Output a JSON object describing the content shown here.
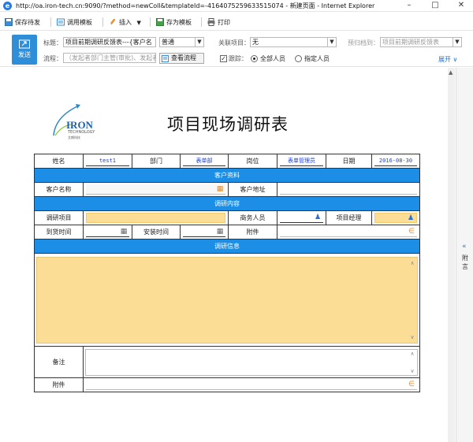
{
  "window": {
    "title": "http://oa.iron-tech.cn:9090/?method=newColl&templateId=-4164075259633515074 - 新建页面 - Internet Explorer",
    "ie_icon": "e"
  },
  "toolbar": {
    "save_draft": "保存待发",
    "use_template": "调用模板",
    "insert": "插入",
    "save_template": "存为模板",
    "print": "打印"
  },
  "header": {
    "send_label": "发送",
    "title_label": "标题：",
    "title_value": "项目前期调研反馈表---{客户名",
    "priority_value": "普通",
    "related_label": "关联项目：",
    "related_value": "无",
    "archive_label": "预归档到：",
    "archive_placeholder": "项目前期调研反馈表",
    "flow_label": "流程：",
    "flow_placeholder": "（发起者部门主管(审批)、发起者",
    "view_flow": "查看流程",
    "track_label": "跟踪：",
    "all_people": "全部人员",
    "specified_people": "指定人员",
    "expand": "展开"
  },
  "side_panel": {
    "label": "附言"
  },
  "document": {
    "logo_brand": "IRON",
    "logo_sub": "TECHNOLOGY",
    "logo_cn": "艾朗科技",
    "title": "项目现场调研表",
    "rows": {
      "name_label": "姓名",
      "name_value": "test1",
      "dept_label": "部门",
      "dept_value": "表单部",
      "post_label": "岗位",
      "post_value": "表单管理员",
      "date_label": "日期",
      "date_value": "2016-08-30",
      "section_customer": "客户资料",
      "customer_name_label": "客户名称",
      "customer_addr_label": "客户地址",
      "section_content": "调研内容",
      "project_label": "调研项目",
      "biz_staff_label": "商务人员",
      "pm_label": "项目经理",
      "arrive_label": "到货时间",
      "install_label": "安装时间",
      "attach_label": "附件",
      "section_info": "调研信息",
      "remark_label": "备注",
      "attach2_label": "附件"
    }
  },
  "colors": {
    "accent_blue": "#1c8ee6",
    "field_yellow": "#fbdd95",
    "value_blue": "#1d3fd6"
  }
}
